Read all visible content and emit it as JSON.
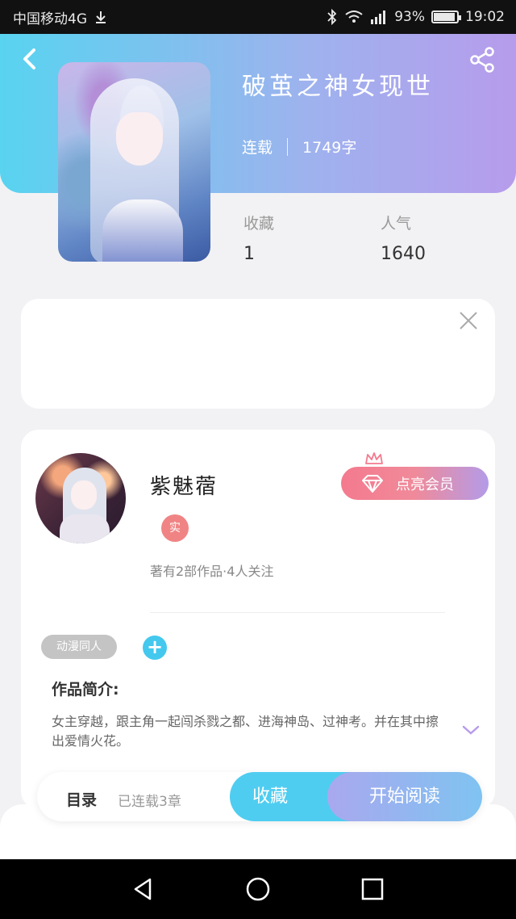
{
  "status_bar": {
    "carrier": "中国移动4G",
    "battery": "93%",
    "battery_level": 0.93,
    "time": "19:02",
    "icons": [
      "download-icon",
      "bluetooth-icon",
      "wifi-icon",
      "signal-icon",
      "battery-icon"
    ]
  },
  "book": {
    "title": "破茧之神女现世",
    "status": "连载",
    "word_count": "1749字",
    "favorites_label": "收藏",
    "favorites_value": "1",
    "popularity_label": "人气",
    "popularity_value": "1640"
  },
  "author": {
    "name": "紫魅蓿",
    "badge": "实",
    "stats": "著有2部作品·4人关注",
    "vip_button": "点亮会员"
  },
  "tags": [
    "动漫同人"
  ],
  "intro": {
    "label": "作品简介:",
    "text": "女主穿越，跟主角一起闯杀戮之都、进海神岛、过神考。并在其中擦出爱情火花。"
  },
  "actions": {
    "toc": "目录",
    "chapter_count": "已连载3章",
    "collect": "收藏",
    "read": "开始阅读"
  },
  "colors": {
    "header_start": "#58d3f0",
    "header_end": "#b79cec",
    "accent_blue": "#44c8ee",
    "vip_pink": "#f47a8e"
  }
}
